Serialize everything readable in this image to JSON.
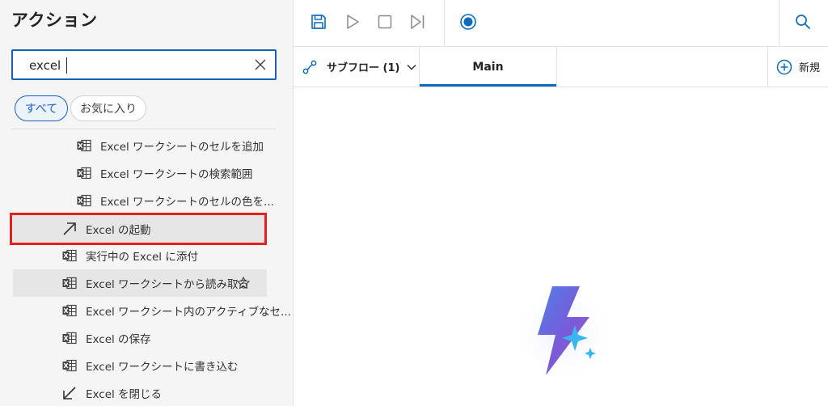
{
  "actions_pane": {
    "title": "アクション",
    "search": {
      "value": "excel"
    },
    "filters": {
      "all": "すべて",
      "favorites": "お気に入り"
    },
    "items": [
      {
        "label": "Excel ワークシートのセルを追加",
        "icon": "excel-icon"
      },
      {
        "label": "Excel ワークシートの検索範囲",
        "icon": "excel-icon"
      },
      {
        "label": "Excel ワークシートのセルの色を...",
        "icon": "excel-icon"
      },
      {
        "label": "Excel の起動",
        "icon": "arrow-up-right-icon"
      },
      {
        "label": "実行中の Excel に添付",
        "icon": "excel-icon"
      },
      {
        "label": "Excel ワークシートから読み取る",
        "icon": "excel-icon"
      },
      {
        "label": "Excel ワークシート内のアクティブなセ...",
        "icon": "excel-icon"
      },
      {
        "label": "Excel の保存",
        "icon": "excel-icon"
      },
      {
        "label": "Excel ワークシートに書き込む",
        "icon": "excel-icon"
      },
      {
        "label": "Excel を閉じる",
        "icon": "arrow-down-left-icon"
      }
    ]
  },
  "toolbar": {
    "buttons": [
      "save-icon",
      "run-icon",
      "stop-icon",
      "next-step-icon",
      "record-icon",
      "search-icon"
    ]
  },
  "tabs": {
    "subflow": "サブフロー (1)",
    "main": "Main",
    "new": "新規"
  },
  "colors": {
    "accent": "#0f6cbd",
    "highlight": "#e3201b"
  }
}
